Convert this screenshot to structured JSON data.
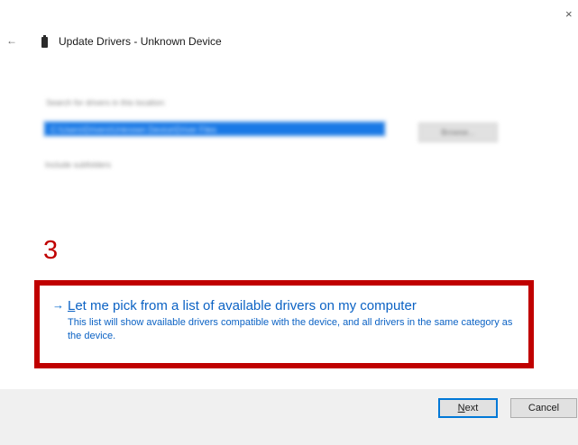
{
  "window": {
    "close_glyph": "×",
    "back_glyph": "←",
    "title": "Update Drivers - Unknown Device"
  },
  "blurred": {
    "search_label": "Search for drivers in this location:",
    "path_value": "C:\\Users\\Drivers\\Unknown Device\\Driver Files",
    "browse_label": "Browse...",
    "include_subfolders": "Include subfolders"
  },
  "annotation": {
    "step_number": "3",
    "accent_color": "#c00000"
  },
  "option": {
    "arrow_glyph": "→",
    "title_first": "L",
    "title_rest": "et me pick from a list of available drivers on my computer",
    "description": "This list will show available drivers compatible with the device, and all drivers in the same category as the device."
  },
  "footer": {
    "next_first": "N",
    "next_rest": "ext",
    "cancel_label": "Cancel"
  }
}
